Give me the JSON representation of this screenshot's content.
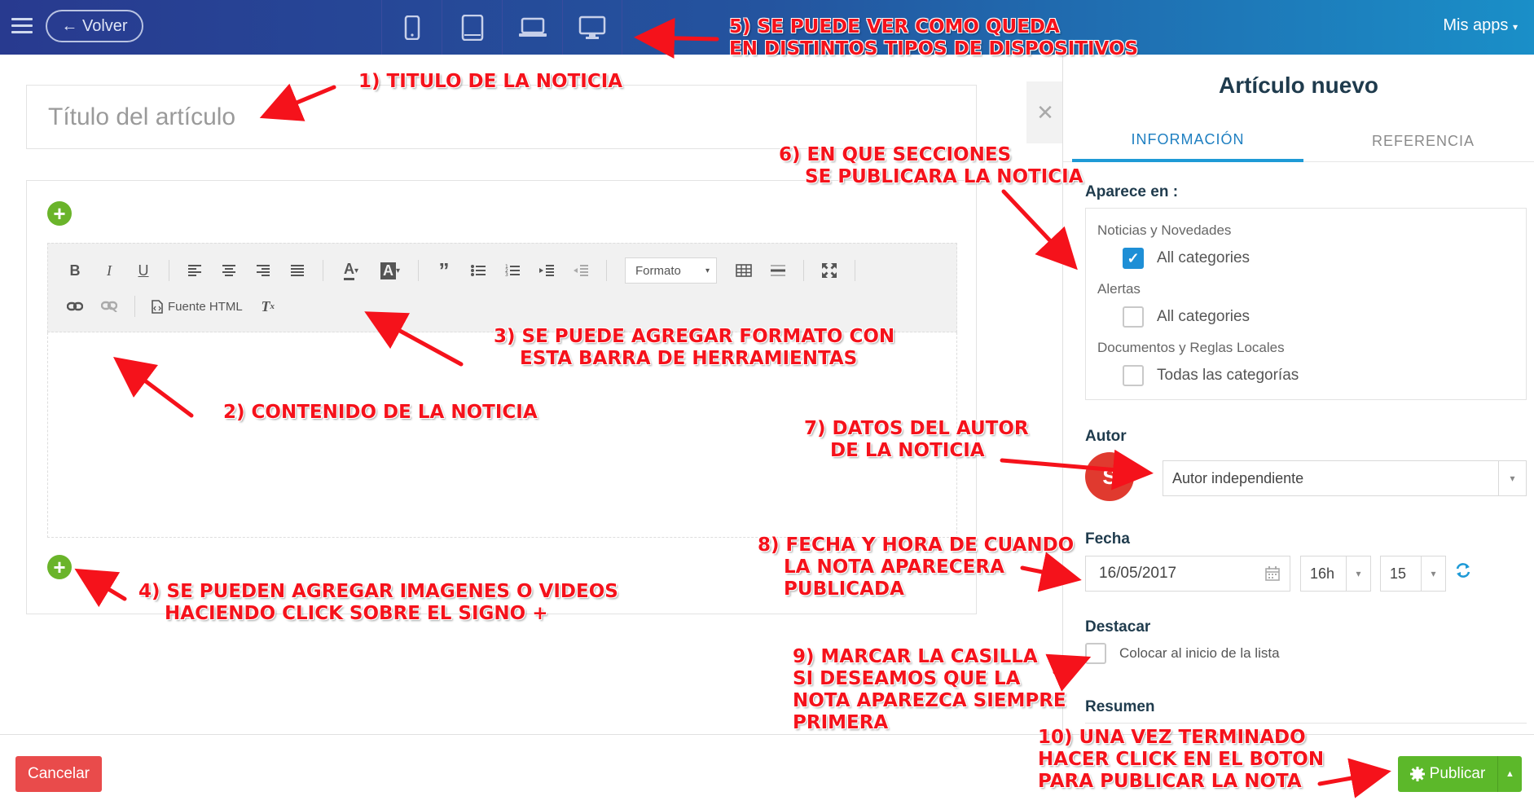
{
  "topbar": {
    "back_label": "← Volver",
    "devices": [
      {
        "name": "phone-icon"
      },
      {
        "name": "tablet-icon"
      },
      {
        "name": "laptop-icon"
      },
      {
        "name": "desktop-icon"
      }
    ],
    "apps_label": "Mis apps"
  },
  "editor": {
    "title_placeholder": "Título del artículo",
    "format_label": "Formato",
    "html_source_label": "Fuente HTML"
  },
  "panel": {
    "title": "Artículo nuevo",
    "tabs": [
      "INFORMACIÓN",
      "REFERENCIA"
    ],
    "appears_in_label": "Aparece en :",
    "groups": [
      {
        "name": "Noticias y Novedades",
        "option": "All categories",
        "checked": true
      },
      {
        "name": "Alertas",
        "option": "All categories",
        "checked": false
      },
      {
        "name": "Documentos y Reglas Locales",
        "option": "Todas las categorías",
        "checked": false
      }
    ],
    "author_label": "Autor",
    "author_initial": "S",
    "author_value": "Autor independiente",
    "date_label": "Fecha",
    "date_value": "16/05/2017",
    "hour_value": "16h",
    "minute_value": "15",
    "featured_label": "Destacar",
    "featured_option": "Colocar al inicio de la lista",
    "summary_label": "Resumen"
  },
  "footer": {
    "cancel_label": "Cancelar",
    "publish_label": "Publicar"
  },
  "annotations": {
    "a1": "1) TITULO DE LA NOTICIA",
    "a2": "2) CONTENIDO DE LA NOTICIA",
    "a3": "3) SE PUEDE AGREGAR FORMATO CON\n    ESTA BARRA DE HERRAMIENTAS",
    "a4": "4) SE PUEDEN AGREGAR IMAGENES O VIDEOS\n    HACIENDO CLICK SOBRE EL SIGNO +",
    "a5": "5) SE PUEDE VER COMO QUEDA\nEN DISTINTOS TIPOS DE DISPOSITIVOS",
    "a6": "6) EN QUE SECCIONES\n    SE PUBLICARA LA NOTICIA",
    "a7": "7) DATOS DEL AUTOR\n    DE LA NOTICIA",
    "a8": "8) FECHA Y HORA DE CUANDO\n    LA NOTA APARECERA\n    PUBLICADA",
    "a9": "9) MARCAR LA CASILLA\nSI DESEAMOS QUE LA\nNOTA APAREZCA SIEMPRE\nPRIMERA",
    "a10": "10) UNA VEZ TERMINADO\nHACER CLICK EN EL BOTON\nPARA PUBLICAR LA NOTA"
  },
  "colors": {
    "accent": "#1e9ad6",
    "annotation": "#f5121b",
    "publish": "#5cb82a",
    "cancel": "#e94b4b"
  }
}
